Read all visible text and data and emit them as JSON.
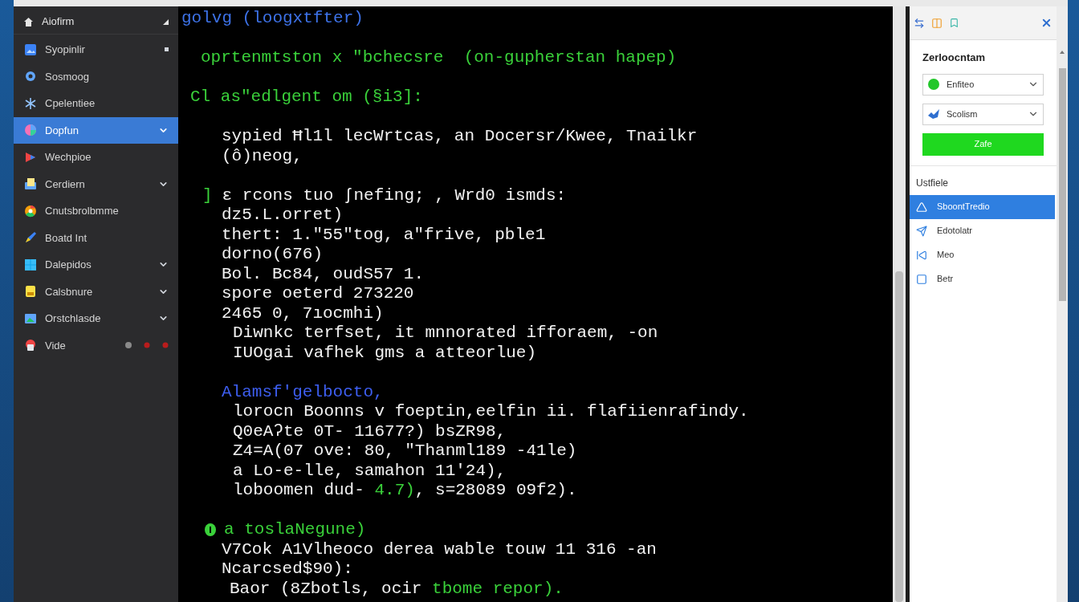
{
  "sidebar": {
    "header": {
      "label": "Aiofirm"
    },
    "items": [
      {
        "label": "Syopinlir",
        "selected": false,
        "kind": "dot"
      },
      {
        "label": "Sosmoog",
        "selected": false,
        "kind": "plain"
      },
      {
        "label": "Cpelentiee",
        "selected": false,
        "kind": "plain"
      },
      {
        "label": "Dopfun",
        "selected": true,
        "kind": "chevron"
      },
      {
        "label": "Wechpioe",
        "selected": false,
        "kind": "plain"
      },
      {
        "label": "Cerdiern",
        "selected": false,
        "kind": "chevron"
      },
      {
        "label": "Cnutsbrolbmme",
        "selected": false,
        "kind": "plain"
      },
      {
        "label": "Boatd Int",
        "selected": false,
        "kind": "plain"
      },
      {
        "label": "Dalepidos",
        "selected": false,
        "kind": "chevron"
      },
      {
        "label": "Calsbnure",
        "selected": false,
        "kind": "chevron"
      },
      {
        "label": "Orstchlasde",
        "selected": false,
        "kind": "chevron"
      },
      {
        "label": "Vide",
        "selected": false,
        "kind": "dots"
      }
    ]
  },
  "terminal": {
    "blocks": [
      [
        {
          "kind": "prompt",
          "text": "golvg (loogxtfter)"
        }
      ],
      [
        {
          "kind": "note",
          "text": "oprtenmtston x \"bchecsre  (on-gupherstan hapep)"
        }
      ],
      [
        {
          "kind": "section",
          "text": "Cl as\"edlgent om (§i3]:"
        }
      ],
      [
        {
          "kind": "body",
          "text": "sypied Ħl1l lecWrtcas, an Docersr/Kwee, Tnailkr"
        },
        {
          "kind": "body",
          "text": "(ô)neog,"
        }
      ],
      [
        {
          "kind": "marked",
          "segments": [
            {
              "kind": "green",
              "text": "]"
            },
            {
              "kind": "plain",
              "text": "ɛ rcons tuo ʃnefing; , Wrd0 ismds:"
            }
          ]
        },
        {
          "kind": "body",
          "text": "dz5.L.orret)"
        },
        {
          "kind": "body",
          "text": "thert: 1.\"55\"tog, a\"frive, pble1"
        },
        {
          "kind": "body",
          "text": "dorno(676)"
        },
        {
          "kind": "body",
          "text": "Bol. Bc84, oudS57 1."
        },
        {
          "kind": "body",
          "text": "spore oeterd 273220"
        },
        {
          "kind": "body",
          "text": "2465 0, 7ıocmhi)"
        },
        {
          "kind": "sub",
          "text": "Diwnkc terfset, it mnnorated ifforaem, -on"
        },
        {
          "kind": "sub",
          "text": "IUOgai vafhek gms a atteorlue)"
        }
      ],
      [
        {
          "kind": "head",
          "text": "Alamsf'gelbocto,"
        },
        {
          "kind": "sub",
          "text": "lorocn Boonns v foeptin,eelfin ii. flafiienrafindy."
        },
        {
          "kind": "sub",
          "text": "Q0eAʔte 0T- 11677?) bsZR98,"
        },
        {
          "kind": "sub",
          "text": "Z4=A(07 ove: 80, \"Thanml189 -41le)"
        },
        {
          "kind": "sub",
          "text": "a Lo-e-lle, samahon 11'24),"
        },
        {
          "kind": "sub",
          "segments": [
            {
              "kind": "plain",
              "text": "loboomen dud- "
            },
            {
              "kind": "green",
              "text": "4.7)"
            },
            {
              "kind": "plain",
              "text": ", s=28089 09f2)."
            }
          ]
        }
      ],
      [
        {
          "kind": "alert",
          "text": "a toslaNegune)"
        },
        {
          "kind": "body",
          "text": "V7Cok A1Vlheoco derea wable touw 11 316 -an"
        },
        {
          "kind": "body",
          "text": "Ncarcsed$90):"
        },
        {
          "kind": "body2",
          "segments": [
            {
              "kind": "plain",
              "text": "Baor (8Zbotls, ocir "
            },
            {
              "kind": "green",
              "text": "tbome repor)."
            }
          ]
        }
      ]
    ]
  },
  "panel": {
    "title": "Zerloocntam",
    "selects": [
      {
        "value": "Enfiteo"
      },
      {
        "value": "Scolism"
      }
    ],
    "button": "Zafe",
    "list_title": "Ustfiele",
    "items": [
      {
        "label": "SboontTredio",
        "selected": true
      },
      {
        "label": "Edotolatr",
        "selected": false
      },
      {
        "label": "Meo",
        "selected": false
      },
      {
        "label": "Betr",
        "selected": false
      }
    ]
  }
}
